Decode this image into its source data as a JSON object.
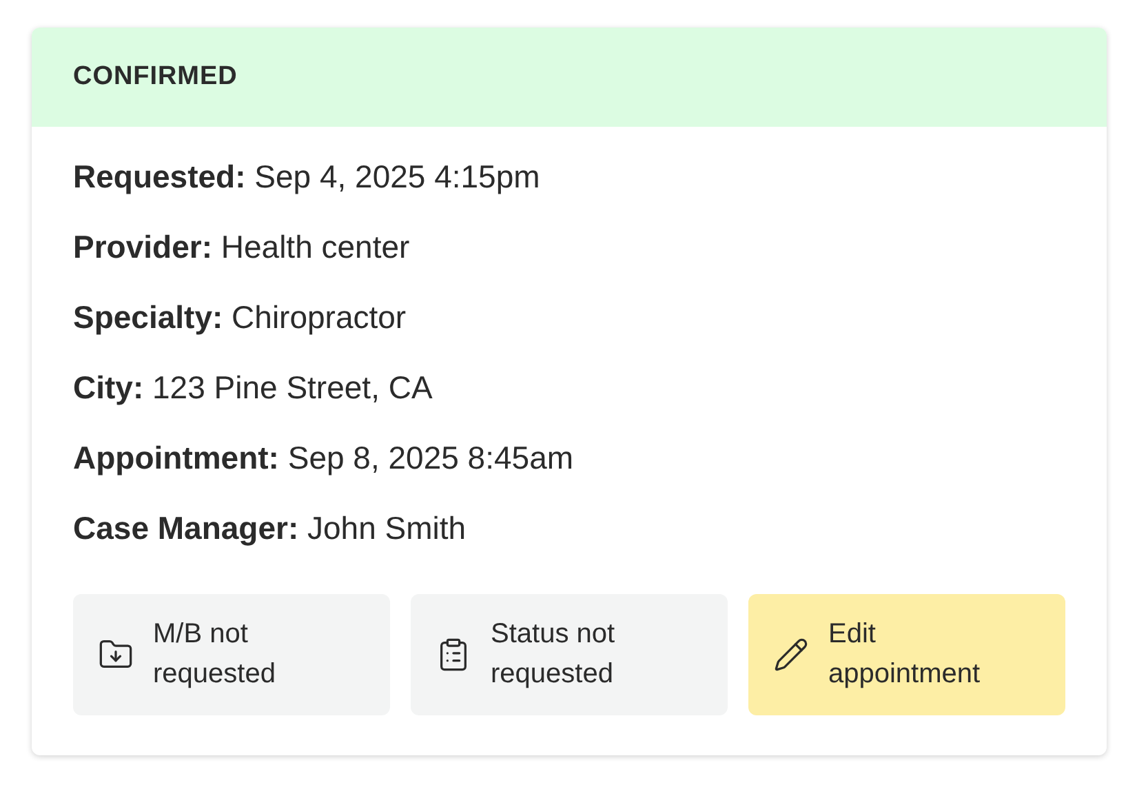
{
  "status": {
    "label": "CONFIRMED"
  },
  "details": [
    {
      "text": "**Requested:** Sep 4, 2025 4:15pm"
    },
    {
      "text": "**Provider:** Health center"
    },
    {
      "text": "**Specialty:** Chiropractor"
    },
    {
      "text": "**City:** 123 Pine Street, CA"
    },
    {
      "text": "**Appointment:** Sep 8, 2025 8:45am"
    },
    {
      "text": "**Case Manager:** John Smith"
    }
  ],
  "buttons": [
    {
      "kind": "records",
      "label": "M/B not requested"
    },
    {
      "kind": "status",
      "label": "Status not requested"
    },
    {
      "kind": "edit",
      "label": "Edit appointment"
    }
  ]
}
